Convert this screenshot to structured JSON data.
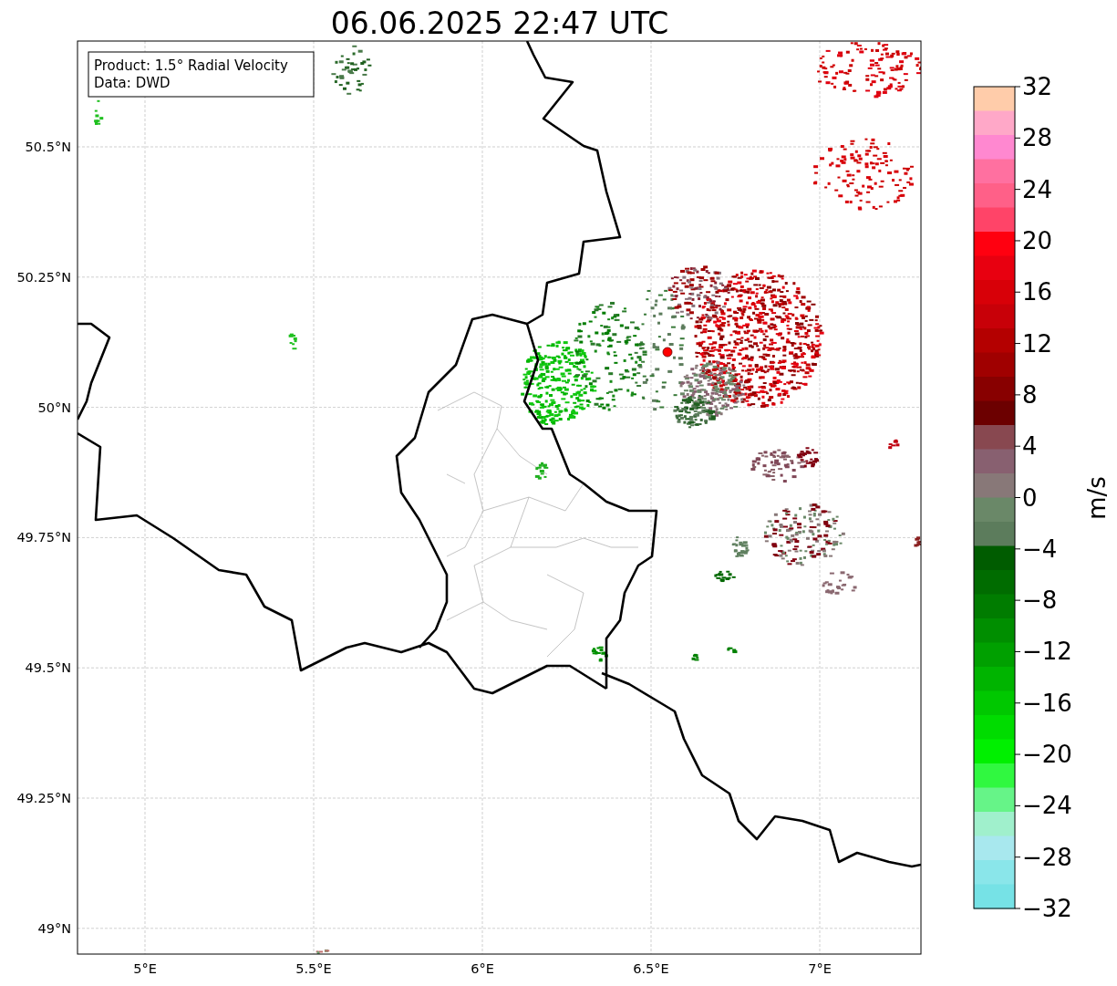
{
  "title": "06.06.2025 22:47 UTC",
  "info_box": [
    "Product: 1.5° Radial Velocity",
    "Data: DWD"
  ],
  "map": {
    "longitude_ticks": [
      "5°E",
      "5.5°E",
      "6°E",
      "6.5°E",
      "7°E"
    ],
    "latitude_ticks": [
      "50.5°N",
      "50.25°N",
      "50°N",
      "49.75°N",
      "49.5°N",
      "49.25°N",
      "49°N"
    ]
  },
  "colorbar": {
    "label": "m/s",
    "ticks": [
      "32",
      "28",
      "24",
      "20",
      "16",
      "12",
      "8",
      "4",
      "0",
      "−4",
      "−8",
      "−12",
      "−16",
      "−20",
      "−24",
      "−28",
      "−32"
    ],
    "bins": [
      {
        "color": "#ffccaa"
      },
      {
        "color": "#ffa8c8"
      },
      {
        "color": "#ff88d0"
      },
      {
        "color": "#ff70a0"
      },
      {
        "color": "#ff6088"
      },
      {
        "color": "#ff4468"
      },
      {
        "color": "#ff0010"
      },
      {
        "color": "#e80010"
      },
      {
        "color": "#d80008"
      },
      {
        "color": "#c80008"
      },
      {
        "color": "#b40000"
      },
      {
        "color": "#a00000"
      },
      {
        "color": "#880000"
      },
      {
        "color": "#6c0000"
      },
      {
        "color": "#884850"
      },
      {
        "color": "#886070"
      },
      {
        "color": "#887878"
      },
      {
        "color": "#6a8868"
      },
      {
        "color": "#5c7c5c"
      },
      {
        "color": "#005c00"
      },
      {
        "color": "#006c00"
      },
      {
        "color": "#007c00"
      },
      {
        "color": "#008e00"
      },
      {
        "color": "#00a000"
      },
      {
        "color": "#00b400"
      },
      {
        "color": "#00c800"
      },
      {
        "color": "#00dc00"
      },
      {
        "color": "#00f000"
      },
      {
        "color": "#30f840"
      },
      {
        "color": "#66f488"
      },
      {
        "color": "#a0f0cc"
      },
      {
        "color": "#a8e8ee"
      },
      {
        "color": "#8ae6ea"
      },
      {
        "color": "#76e2e6"
      }
    ]
  }
}
